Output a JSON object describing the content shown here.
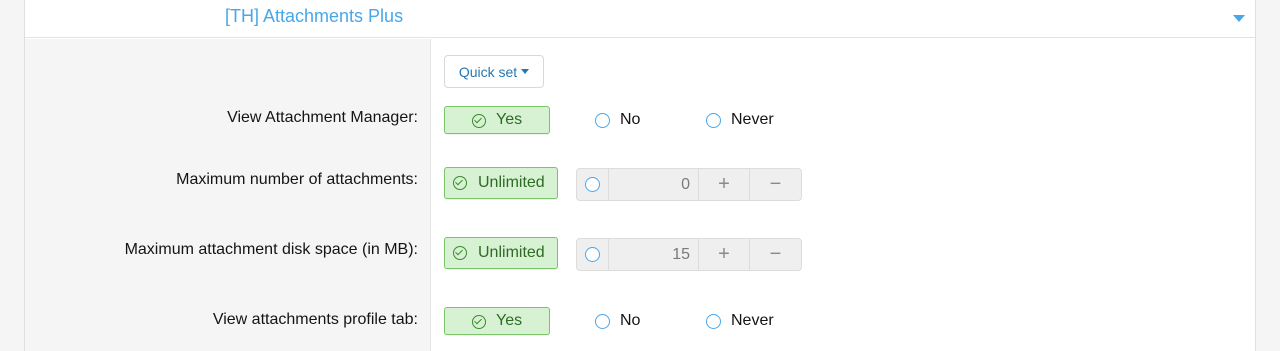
{
  "header": {
    "title": "[TH] Attachments Plus"
  },
  "quick_set": {
    "label": "Quick set"
  },
  "rows": [
    {
      "label": "View Attachment Manager:",
      "selected": "Yes",
      "options": [
        "No",
        "Never"
      ]
    },
    {
      "label": "Maximum number of attachments:",
      "selected": "Unlimited",
      "value": "0",
      "plus": "+",
      "minus": "−"
    },
    {
      "label": "Maximum attachment disk space (in MB):",
      "selected": "Unlimited",
      "value": "15",
      "plus": "+",
      "minus": "−"
    },
    {
      "label": "View attachments profile tab:",
      "selected": "Yes",
      "options": [
        "No",
        "Never"
      ]
    }
  ],
  "colors": {
    "accent": "#47a7eb",
    "selected_bg": "#d7f2d2",
    "selected_border": "#7cc46a"
  }
}
